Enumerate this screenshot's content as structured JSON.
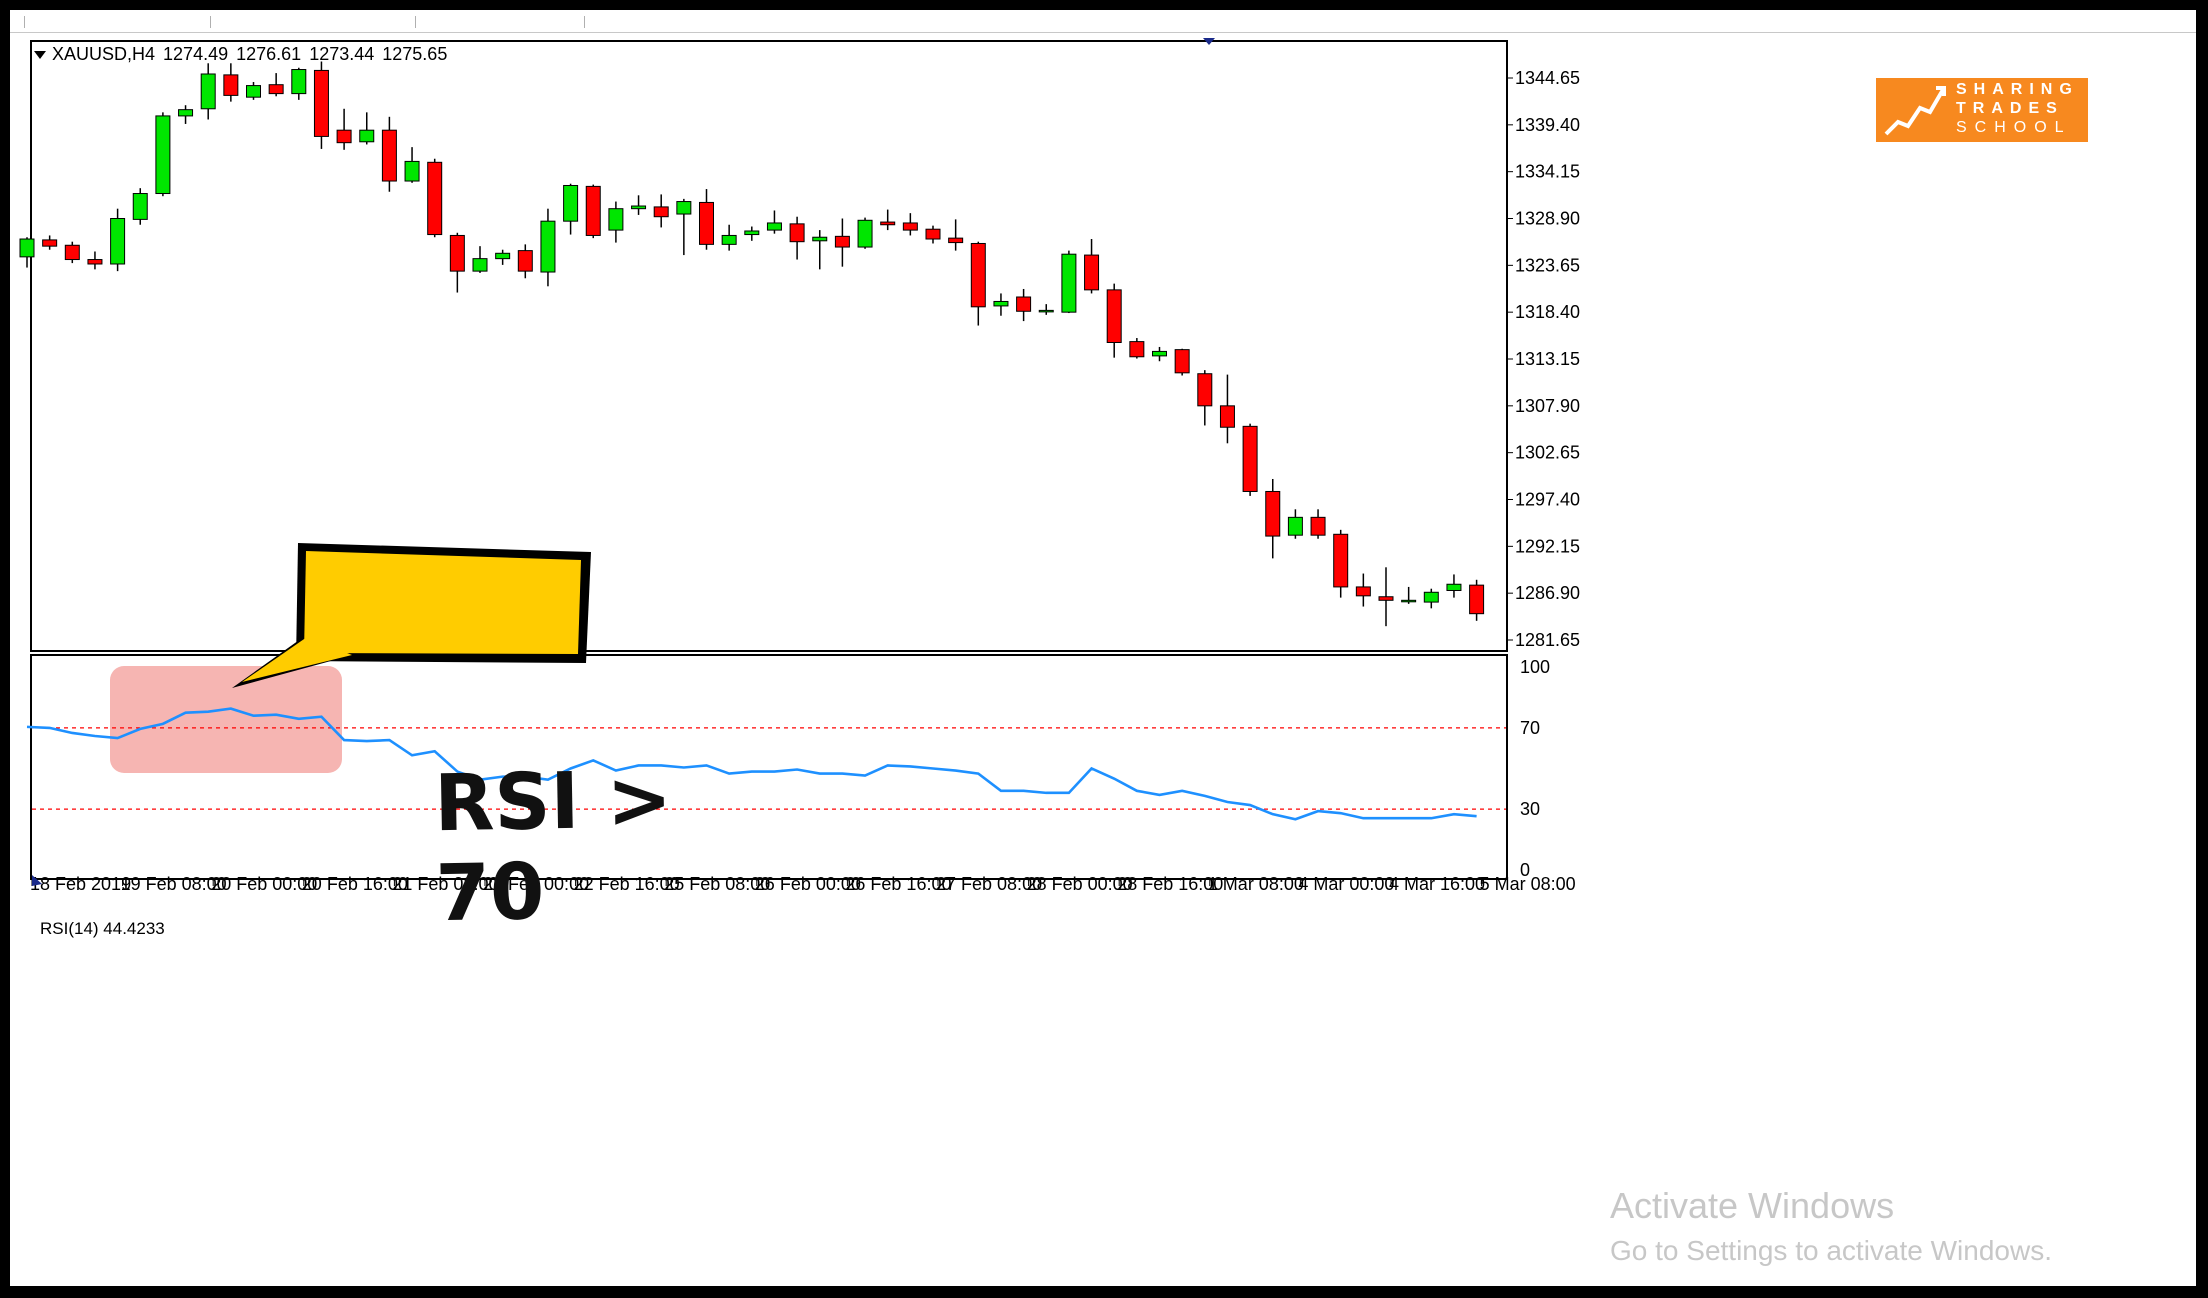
{
  "header": {
    "symbol": "XAUUSD,H4",
    "open": "1274.49",
    "high": "1276.61",
    "low": "1273.44",
    "close": "1275.65"
  },
  "rsi_header": "RSI(14) 44.4233",
  "logo": {
    "line1": "SHARING",
    "line2": "TRADES",
    "line3": "SCHOOL"
  },
  "callout": "RSI > 70",
  "watermark": {
    "line1": "Activate Windows",
    "line2": "Go to Settings to activate Windows."
  },
  "colors": {
    "bull": "#00e600",
    "bear": "#ff0000",
    "rsi_line": "#1e90ff",
    "level_line": "#ff0000",
    "highlight": "#f4a8a4",
    "callout_fill": "#ffcc00",
    "logo": "#f7891f"
  },
  "chart_data": [
    {
      "type": "candlestick",
      "title": "XAUUSD,H4",
      "price_ticks": [
        "1344.65",
        "1339.40",
        "1334.15",
        "1328.90",
        "1323.65",
        "1318.40",
        "1313.15",
        "1307.90",
        "1302.65",
        "1297.40",
        "1292.15",
        "1286.90",
        "1281.65"
      ],
      "ylim": [
        1281.65,
        1348.0
      ],
      "time_labels": [
        "18 Feb 2019",
        "19 Feb 08:00",
        "20 Feb 00:00",
        "20 Feb 16:00",
        "21 Feb 08:00",
        "22 Feb 00:00",
        "22 Feb 16:00",
        "25 Feb 08:00",
        "26 Feb 00:00",
        "26 Feb 16:00",
        "27 Feb 08:00",
        "28 Feb 00:00",
        "28 Feb 16:00",
        "1 Mar 08:00",
        "4 Mar 00:00",
        "4 Mar 16:00",
        "5 Mar 08:00"
      ],
      "ohlc": [
        [
          1324.6,
          1326.8,
          1323.4,
          1326.6
        ],
        [
          1326.5,
          1327.0,
          1325.4,
          1325.8
        ],
        [
          1325.9,
          1326.3,
          1323.9,
          1324.3
        ],
        [
          1324.3,
          1325.2,
          1323.2,
          1323.8
        ],
        [
          1323.8,
          1330.0,
          1323.0,
          1328.9
        ],
        [
          1328.8,
          1332.3,
          1328.2,
          1331.7
        ],
        [
          1331.7,
          1340.8,
          1331.4,
          1340.4
        ],
        [
          1340.4,
          1341.6,
          1339.5,
          1341.1
        ],
        [
          1341.2,
          1346.3,
          1340.0,
          1345.1
        ],
        [
          1345.0,
          1346.3,
          1342.0,
          1342.7
        ],
        [
          1342.5,
          1344.2,
          1342.2,
          1343.8
        ],
        [
          1343.9,
          1345.2,
          1342.6,
          1342.9
        ],
        [
          1342.9,
          1345.8,
          1342.2,
          1345.6
        ],
        [
          1345.5,
          1346.5,
          1336.7,
          1338.1
        ],
        [
          1338.8,
          1341.2,
          1336.6,
          1337.4
        ],
        [
          1337.5,
          1340.8,
          1337.2,
          1338.8
        ],
        [
          1338.8,
          1340.3,
          1331.9,
          1333.1
        ],
        [
          1333.1,
          1336.9,
          1332.9,
          1335.3
        ],
        [
          1335.2,
          1335.6,
          1326.8,
          1327.1
        ],
        [
          1327.0,
          1327.3,
          1320.6,
          1323.0
        ],
        [
          1323.0,
          1325.8,
          1322.8,
          1324.4
        ],
        [
          1324.4,
          1325.4,
          1323.7,
          1325.0
        ],
        [
          1325.3,
          1326.0,
          1322.2,
          1323.0
        ],
        [
          1322.9,
          1330.0,
          1321.3,
          1328.6
        ],
        [
          1328.6,
          1332.8,
          1327.1,
          1332.6
        ],
        [
          1332.5,
          1332.7,
          1326.7,
          1327.0
        ],
        [
          1327.6,
          1330.8,
          1326.2,
          1330.0
        ],
        [
          1330.0,
          1331.5,
          1329.3,
          1330.3
        ],
        [
          1330.2,
          1331.6,
          1327.9,
          1329.1
        ],
        [
          1329.4,
          1331.1,
          1324.8,
          1330.8
        ],
        [
          1330.7,
          1332.2,
          1325.4,
          1326.0
        ],
        [
          1326.0,
          1328.2,
          1325.3,
          1327.0
        ],
        [
          1327.1,
          1328.0,
          1326.4,
          1327.5
        ],
        [
          1327.6,
          1329.8,
          1327.2,
          1328.4
        ],
        [
          1328.3,
          1329.1,
          1324.3,
          1326.3
        ],
        [
          1326.4,
          1327.6,
          1323.2,
          1326.8
        ],
        [
          1326.9,
          1328.9,
          1323.5,
          1325.7
        ],
        [
          1325.7,
          1329.0,
          1325.5,
          1328.7
        ],
        [
          1328.5,
          1329.9,
          1327.6,
          1328.2
        ],
        [
          1328.4,
          1329.5,
          1327.0,
          1327.6
        ],
        [
          1327.7,
          1328.1,
          1326.1,
          1326.6
        ],
        [
          1326.7,
          1328.8,
          1325.3,
          1326.2
        ],
        [
          1326.1,
          1326.3,
          1316.9,
          1319.0
        ],
        [
          1319.1,
          1320.5,
          1318.0,
          1319.6
        ],
        [
          1320.1,
          1321.0,
          1317.4,
          1318.5
        ],
        [
          1318.5,
          1319.3,
          1318.1,
          1318.6
        ],
        [
          1318.4,
          1325.3,
          1318.3,
          1324.9
        ],
        [
          1324.8,
          1326.6,
          1320.5,
          1320.9
        ],
        [
          1320.9,
          1321.6,
          1313.3,
          1315.0
        ],
        [
          1315.1,
          1315.5,
          1313.2,
          1313.4
        ],
        [
          1313.5,
          1314.5,
          1312.9,
          1314.0
        ],
        [
          1314.2,
          1314.3,
          1311.3,
          1311.6
        ],
        [
          1311.5,
          1311.9,
          1305.7,
          1307.9
        ],
        [
          1307.9,
          1311.4,
          1303.7,
          1305.5
        ],
        [
          1305.6,
          1305.9,
          1297.8,
          1298.3
        ],
        [
          1298.3,
          1299.7,
          1290.8,
          1293.3
        ],
        [
          1293.4,
          1296.3,
          1293.0,
          1295.4
        ],
        [
          1295.4,
          1296.3,
          1293.0,
          1293.4
        ],
        [
          1293.5,
          1294.0,
          1286.4,
          1287.6
        ],
        [
          1287.6,
          1289.1,
          1285.4,
          1286.6
        ],
        [
          1286.5,
          1289.8,
          1283.2,
          1286.1
        ],
        [
          1286.0,
          1287.6,
          1285.7,
          1286.1
        ],
        [
          1285.9,
          1287.4,
          1285.2,
          1287.0
        ],
        [
          1287.2,
          1289.0,
          1286.4,
          1287.9
        ],
        [
          1287.8,
          1288.4,
          1283.8,
          1284.6
        ]
      ]
    },
    {
      "type": "line",
      "title": "RSI(14) 44.4233",
      "ylim": [
        0,
        100
      ],
      "y_ticks": [
        "100",
        "70",
        "30",
        "0"
      ],
      "levels": [
        70,
        30
      ],
      "series": [
        {
          "values": [
            70.5,
            70.0,
            67.5,
            66.0,
            65.0,
            69.5,
            72.0,
            77.5,
            78.0,
            79.5,
            76.0,
            76.5,
            74.5,
            75.5,
            64.0,
            63.5,
            64.0,
            56.5,
            58.5,
            48.5,
            44.5,
            46.0,
            46.0,
            44.5,
            50.0,
            54.0,
            49.0,
            51.5,
            51.5,
            50.5,
            51.5,
            47.5,
            48.5,
            48.5,
            49.5,
            47.5,
            47.5,
            46.5,
            51.5,
            51.0,
            50.0,
            49.0,
            47.5,
            39.0,
            39.0,
            38.0,
            38.0,
            50.0,
            45.0,
            39.0,
            37.0,
            39.0,
            36.5,
            33.5,
            32.0,
            27.5,
            25.0,
            29.0,
            28.0,
            25.5,
            25.5,
            25.5,
            25.5,
            27.5,
            26.5
          ]
        }
      ]
    }
  ]
}
